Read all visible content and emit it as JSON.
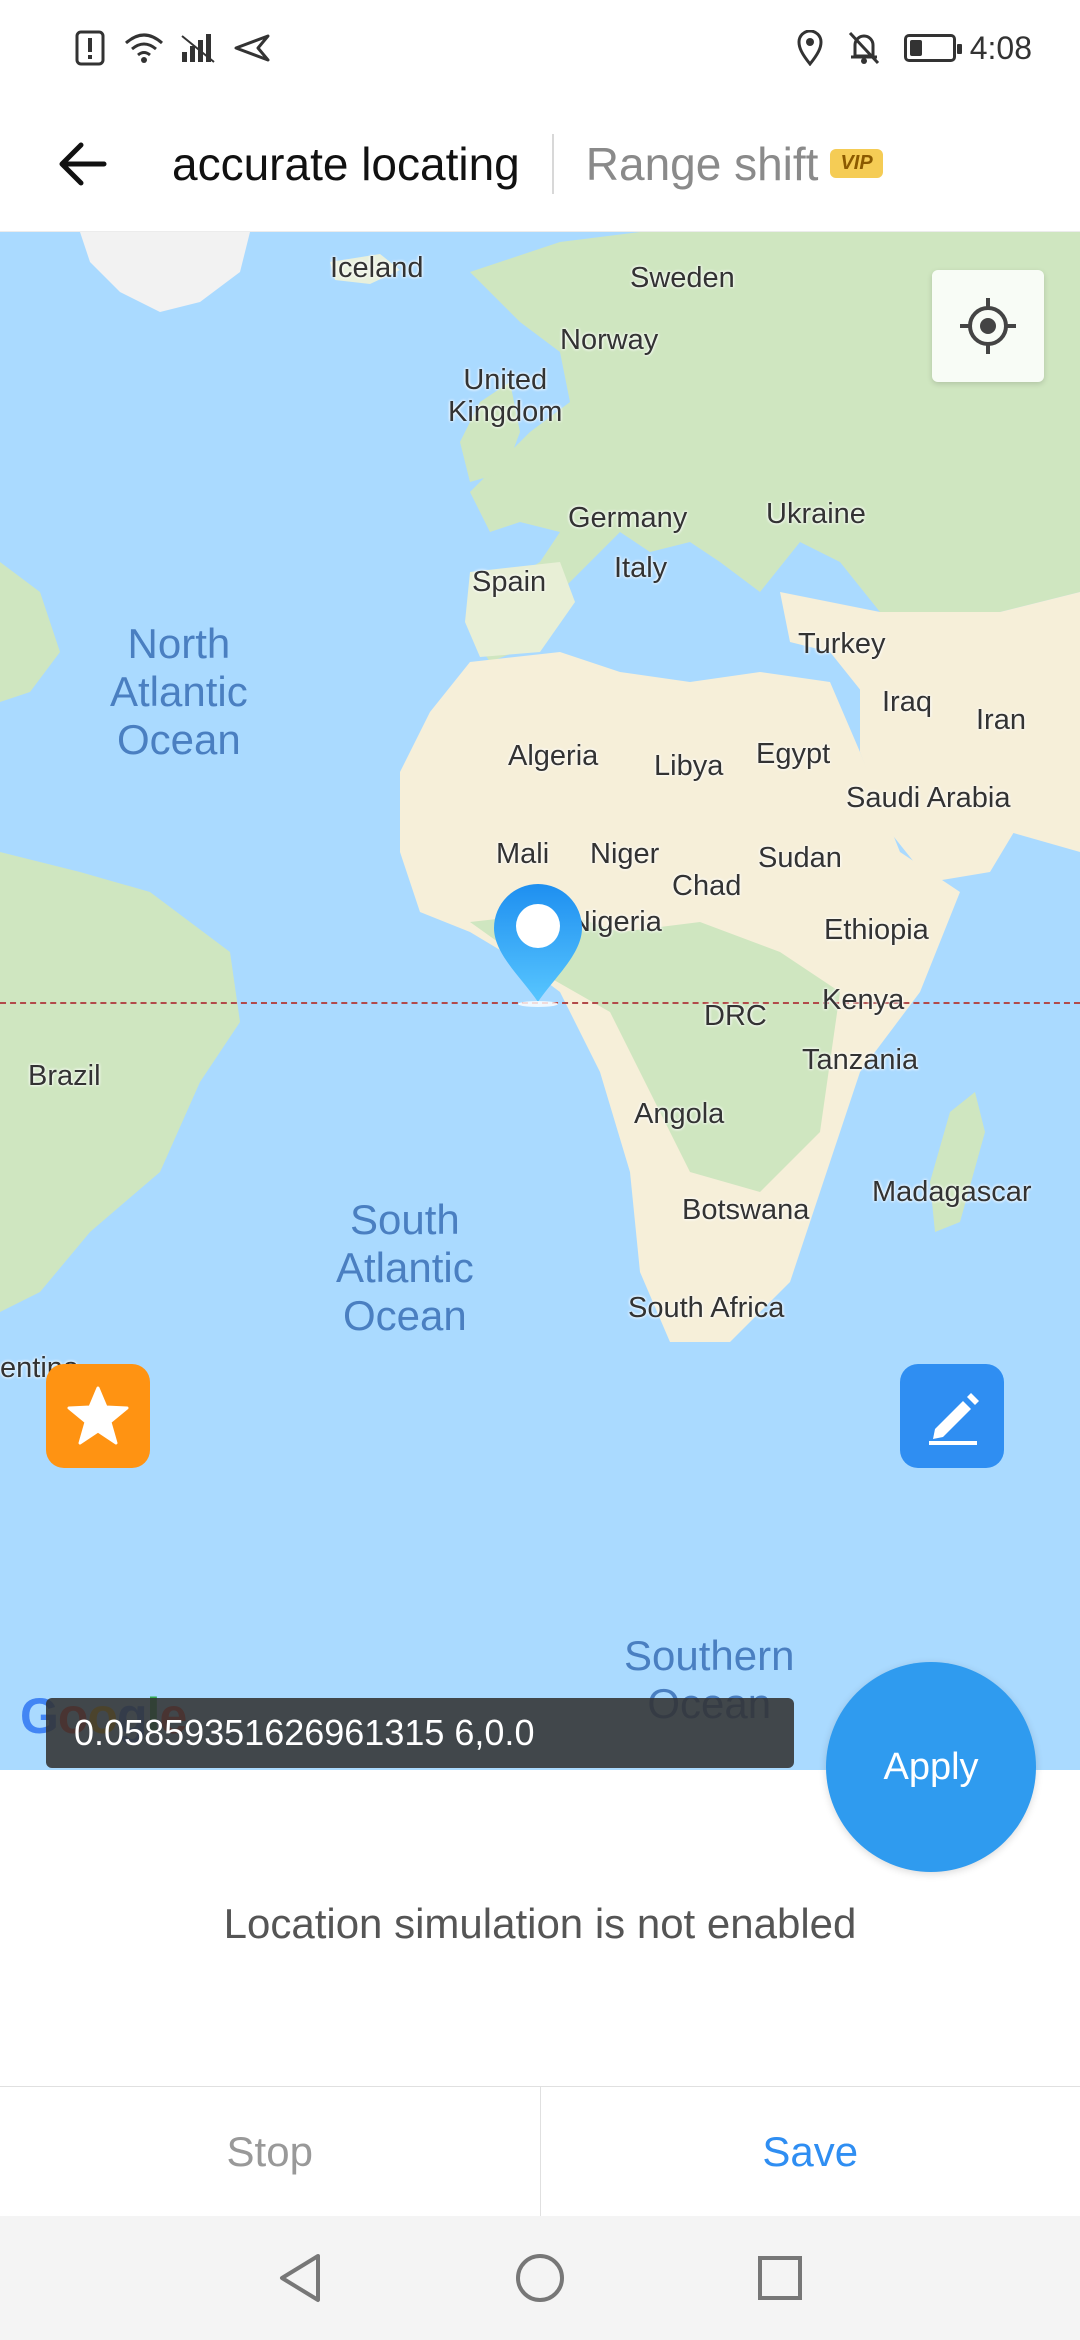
{
  "status_bar": {
    "time": "4:08",
    "icons_left": [
      "alert-icon",
      "wifi-icon",
      "signal-icon",
      "send-icon"
    ],
    "icons_right": [
      "location-icon",
      "mute-bell-icon",
      "battery-icon"
    ]
  },
  "header": {
    "active_tab": "accurate locating",
    "inactive_tab": "Range shift",
    "vip_badge": "VIP"
  },
  "map": {
    "ocean_labels": {
      "north_atlantic": "North\nAtlantic\nOcean",
      "south_atlantic": "South\nAtlantic\nOcean",
      "southern": "Southern\nOcean"
    },
    "place_labels": {
      "iceland": "Iceland",
      "sweden": "Sweden",
      "norway": "Norway",
      "united_kingdom": "United\nKingdom",
      "germany": "Germany",
      "ukraine": "Ukraine",
      "spain": "Spain",
      "italy": "Italy",
      "turkey": "Turkey",
      "iraq": "Iraq",
      "iran": "Iran",
      "algeria": "Algeria",
      "libya": "Libya",
      "egypt": "Egypt",
      "saudi_arabia": "Saudi Arabia",
      "mali": "Mali",
      "niger": "Niger",
      "chad": "Chad",
      "sudan": "Sudan",
      "nigeria": "Nigeria",
      "ethiopia": "Ethiopia",
      "kenya": "Kenya",
      "drc": "DRC",
      "tanzania": "Tanzania",
      "brazil": "Brazil",
      "angola": "Angola",
      "madagascar": "Madagascar",
      "botswana": "Botswana",
      "south_africa": "South Africa",
      "argentina_partial": "entina"
    },
    "google_logo": "Google",
    "coordinates": "0.05859351626961315 6,0.0",
    "apply_label": "Apply"
  },
  "simulation_status": "Location simulation is not enabled",
  "bottom": {
    "stop_label": "Stop",
    "save_label": "Save"
  },
  "colors": {
    "water": "#aadaff",
    "land": "#f6efd9",
    "green": "#cfe6c0",
    "accent_blue": "#2f8ef2",
    "favorite_orange": "#ff9312"
  }
}
